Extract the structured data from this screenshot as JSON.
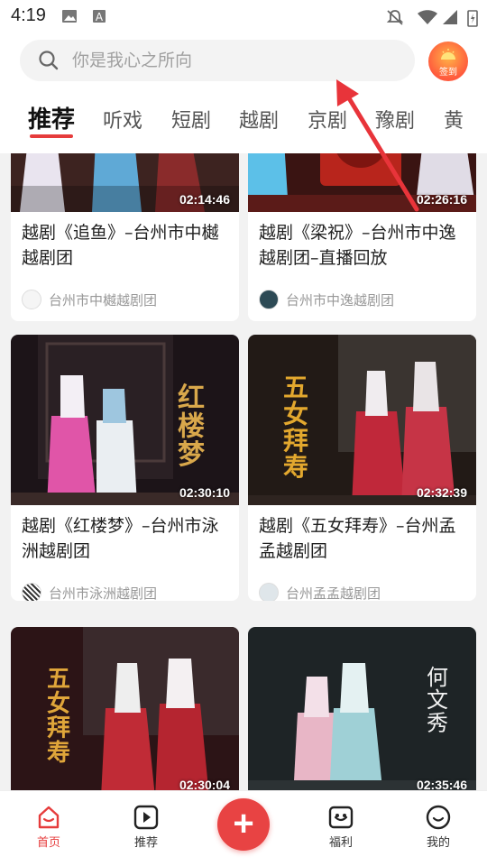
{
  "status_bar": {
    "time": "4:19"
  },
  "search": {
    "placeholder": "你是我心之所向"
  },
  "signin": {
    "label": "签到"
  },
  "tabs": [
    {
      "label": "推荐"
    },
    {
      "label": "听戏"
    },
    {
      "label": "短剧"
    },
    {
      "label": "越剧"
    },
    {
      "label": "京剧"
    },
    {
      "label": "豫剧"
    },
    {
      "label": "黄"
    }
  ],
  "cards": [
    {
      "title": "越剧《追鱼》–台州市中樾越剧团",
      "duration": "02:14:46",
      "author": "台州市中樾越剧团"
    },
    {
      "title": "越剧《梁祝》–台州市中逸越剧团–直播回放",
      "duration": "02:26:16",
      "author": "台州市中逸越剧团"
    },
    {
      "title": "越剧《红楼梦》–台州市泳洲越剧团",
      "duration": "02:30:10",
      "author": "台州市泳洲越剧团",
      "poster_text": "红楼梦"
    },
    {
      "title": "越剧《五女拜寿》–台州孟孟越剧团",
      "duration": "02:32:39",
      "author": "台州孟孟越剧团",
      "poster_text": "五女拜寿"
    },
    {
      "title": "",
      "duration": "02:30:04",
      "author": "",
      "poster_text": "五女拜寿"
    },
    {
      "title": "",
      "duration": "02:35:46",
      "author": "",
      "poster_text": "何文秀"
    }
  ],
  "bottom_nav": [
    {
      "label": "首页",
      "icon": "home-icon",
      "active": true
    },
    {
      "label": "推荐",
      "icon": "play-icon",
      "active": false
    },
    {
      "label": "",
      "icon": "plus-icon",
      "active": false
    },
    {
      "label": "福利",
      "icon": "gift-icon",
      "active": false
    },
    {
      "label": "我的",
      "icon": "smile-icon",
      "active": false
    }
  ],
  "colors": {
    "accent": "#e63c3c",
    "annotation": "#e8343a"
  }
}
